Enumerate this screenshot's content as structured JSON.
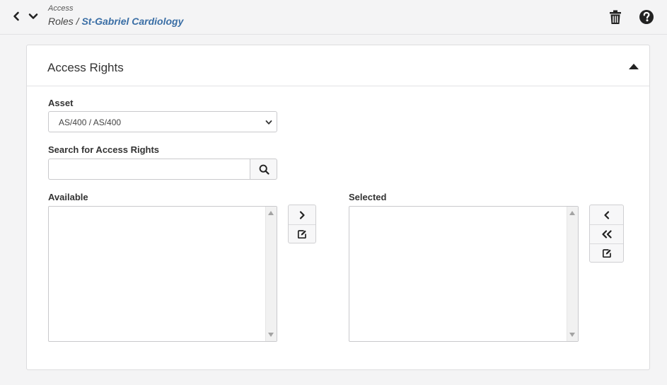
{
  "header": {
    "breadcrumb_parent": "Access",
    "breadcrumb_section": "Roles",
    "breadcrumb_separator": " / ",
    "breadcrumb_current": "St-Gabriel Cardiology"
  },
  "panel": {
    "title": "Access Rights"
  },
  "asset": {
    "label": "Asset",
    "selected_value": "AS/400 / AS/400"
  },
  "search": {
    "label": "Search for Access Rights",
    "value": "",
    "placeholder": ""
  },
  "available": {
    "label": "Available",
    "items": []
  },
  "selected": {
    "label": "Selected",
    "items": []
  },
  "icons": {
    "back": "chevron-left-icon",
    "down": "chevron-down-icon",
    "delete": "trash-icon",
    "help": "question-circle-icon",
    "collapse": "caret-up-icon",
    "search": "search-icon",
    "move_right": "chevron-right-icon",
    "move_left": "chevron-left-icon",
    "move_all_left": "double-chevron-left-icon",
    "edit": "edit-icon"
  },
  "colors": {
    "link": "#3a6ea5",
    "background": "#f4f4f5",
    "panel": "#ffffff"
  }
}
